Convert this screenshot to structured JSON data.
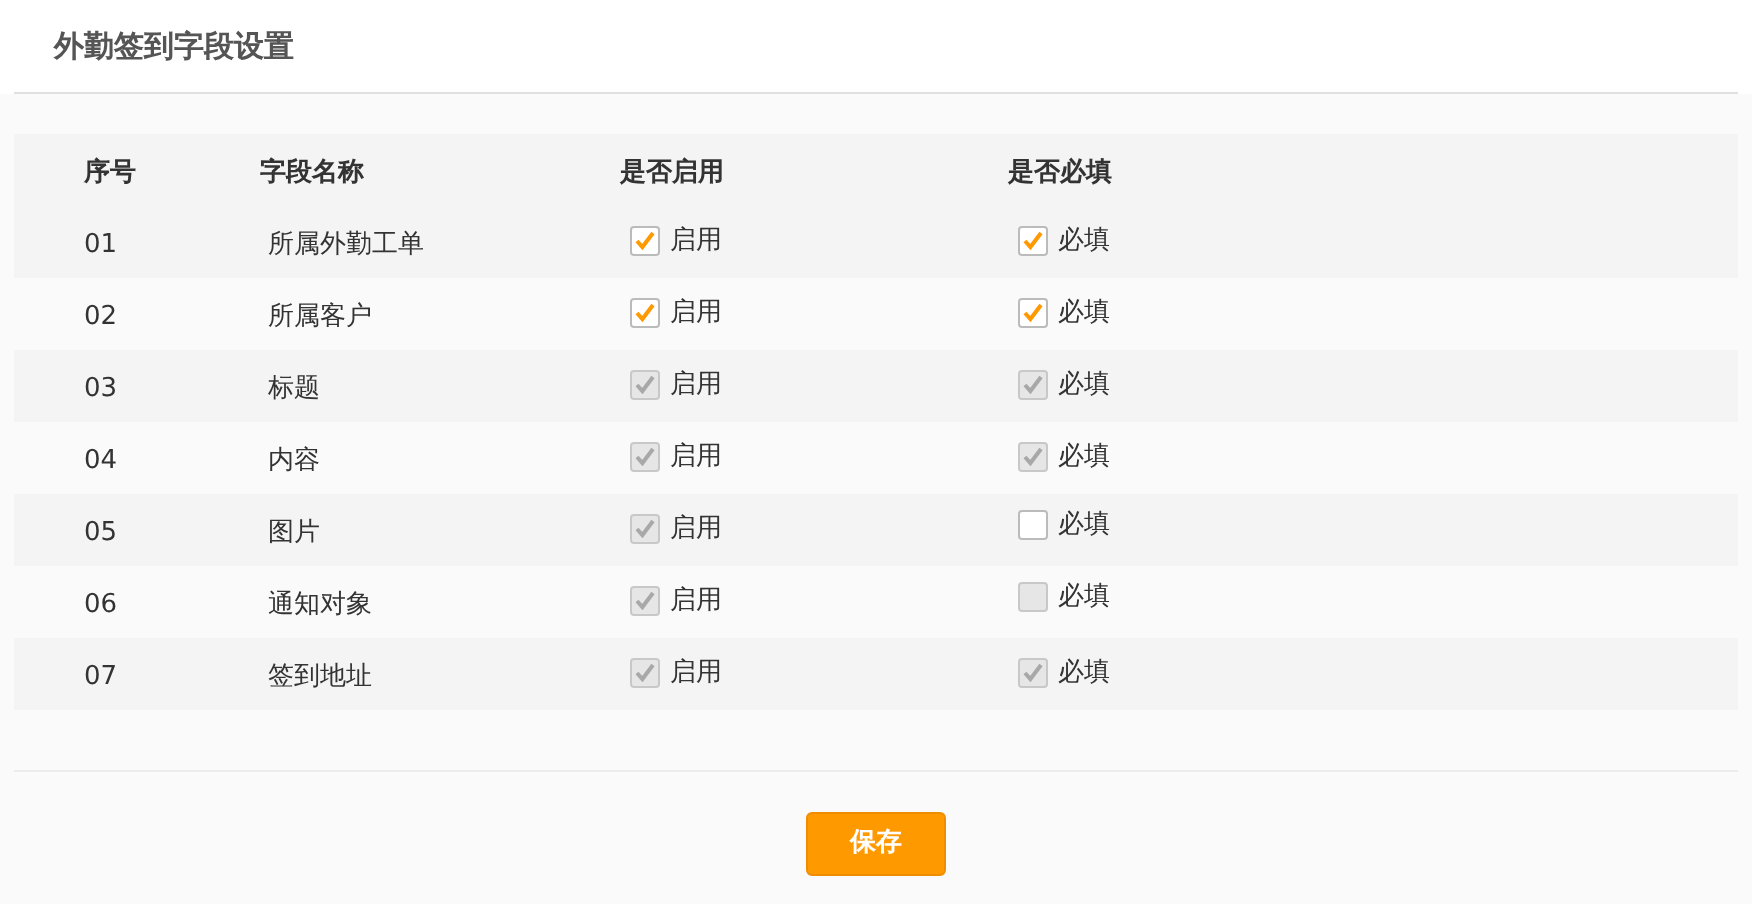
{
  "title": "外勤签到字段设置",
  "table": {
    "columns": [
      "序号",
      "字段名称",
      "是否启用",
      "是否必填"
    ],
    "rows": [
      {
        "index": "01",
        "name": "所属外勤工单",
        "enable": {
          "label": "启用",
          "checked": true,
          "disabled": false
        },
        "required": {
          "label": "必填",
          "checked": true,
          "disabled": false
        }
      },
      {
        "index": "02",
        "name": "所属客户",
        "enable": {
          "label": "启用",
          "checked": true,
          "disabled": false
        },
        "required": {
          "label": "必填",
          "checked": true,
          "disabled": false
        }
      },
      {
        "index": "03",
        "name": "标题",
        "enable": {
          "label": "启用",
          "checked": true,
          "disabled": true
        },
        "required": {
          "label": "必填",
          "checked": true,
          "disabled": true
        }
      },
      {
        "index": "04",
        "name": "内容",
        "enable": {
          "label": "启用",
          "checked": true,
          "disabled": true
        },
        "required": {
          "label": "必填",
          "checked": true,
          "disabled": true
        }
      },
      {
        "index": "05",
        "name": "图片",
        "enable": {
          "label": "启用",
          "checked": true,
          "disabled": true
        },
        "required": {
          "label": "必填",
          "checked": false,
          "disabled": false
        }
      },
      {
        "index": "06",
        "name": "通知对象",
        "enable": {
          "label": "启用",
          "checked": true,
          "disabled": true
        },
        "required": {
          "label": "必填",
          "checked": false,
          "disabled": true
        }
      },
      {
        "index": "07",
        "name": "签到地址",
        "enable": {
          "label": "启用",
          "checked": true,
          "disabled": true
        },
        "required": {
          "label": "必填",
          "checked": true,
          "disabled": true
        }
      }
    ]
  },
  "save_button": "保存"
}
